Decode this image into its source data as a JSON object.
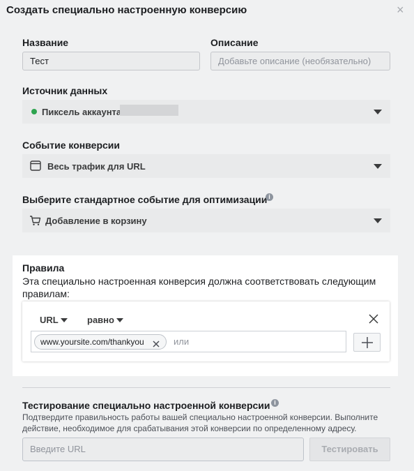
{
  "dialog": {
    "title": "Создать специально настроенную конверсию",
    "close_icon": "close-icon"
  },
  "fields": {
    "name_label": "Название",
    "name_value": "Тест",
    "description_label": "Описание",
    "description_placeholder": "Добавьте описание (необязательно)",
    "data_source_label": "Источник данных",
    "data_source_value": "Пиксель аккаунта",
    "data_source_status_color": "#2ea44f",
    "conversion_event_label": "Событие конверсии",
    "conversion_event_value": "Весь трафик для URL",
    "optimization_label": "Выберите стандартное событие для оптимизации",
    "optimization_value": "Добавление в корзину"
  },
  "rules": {
    "heading": "Правила",
    "description": "Эта специально настроенная конверсия должна соответствовать следующим правилам:",
    "field_dropdown": "URL",
    "operator_dropdown": "равно",
    "tag_value": "www.yoursite.com/thankyou",
    "or_placeholder": "или",
    "add_symbol": "+"
  },
  "test": {
    "heading": "Тестирование специально настроенной конверсии",
    "description": "Подтвердите правильность работы вашей специально настроенной конверсии. Выполните действие, необходимое для срабатывания этой конверсии по определенному адресу.",
    "url_placeholder": "Введите URL",
    "button_label": "Тестировать"
  },
  "icons": {
    "close": "close-icon",
    "info": "info-icon",
    "browser": "browser-window-icon",
    "cart": "shopping-cart-icon",
    "dropdown": "chevron-down-icon",
    "remove": "remove-x-icon",
    "add": "plus-icon"
  }
}
